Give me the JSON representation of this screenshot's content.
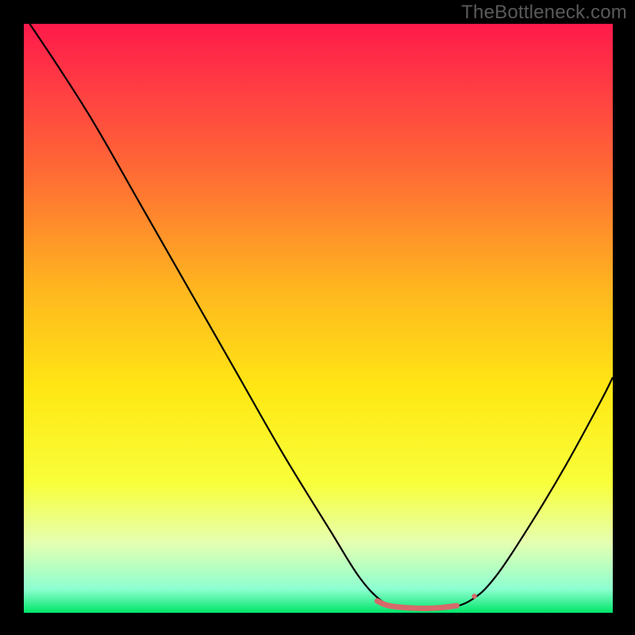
{
  "watermark": "TheBottleneck.com",
  "chart_data": {
    "type": "line",
    "title": "",
    "xlabel": "",
    "ylabel": "",
    "xlim": [
      0,
      100
    ],
    "ylim": [
      0,
      100
    ],
    "background_gradient": {
      "stops": [
        {
          "offset": 0.0,
          "color": "#ff1a4a"
        },
        {
          "offset": 0.1,
          "color": "#ff3a44"
        },
        {
          "offset": 0.25,
          "color": "#ff6a35"
        },
        {
          "offset": 0.45,
          "color": "#ffb61f"
        },
        {
          "offset": 0.62,
          "color": "#ffe714"
        },
        {
          "offset": 0.78,
          "color": "#f8ff3a"
        },
        {
          "offset": 0.88,
          "color": "#e6ffb0"
        },
        {
          "offset": 0.96,
          "color": "#8dffd0"
        },
        {
          "offset": 1.0,
          "color": "#00e56a"
        }
      ]
    },
    "series": [
      {
        "name": "bottleneck-curve",
        "color": "#000000",
        "width": 2.2,
        "comment": "y is mismatch percentage; 0 at bottom (optimum), 100 at top.",
        "points": [
          {
            "x": 1.0,
            "y": 100.0
          },
          {
            "x": 6.0,
            "y": 92.5
          },
          {
            "x": 12.0,
            "y": 83.0
          },
          {
            "x": 20.0,
            "y": 69.0
          },
          {
            "x": 28.0,
            "y": 55.0
          },
          {
            "x": 36.0,
            "y": 41.0
          },
          {
            "x": 44.0,
            "y": 27.0
          },
          {
            "x": 52.0,
            "y": 14.0
          },
          {
            "x": 57.0,
            "y": 6.0
          },
          {
            "x": 61.0,
            "y": 1.8
          },
          {
            "x": 64.0,
            "y": 0.8
          },
          {
            "x": 68.0,
            "y": 0.6
          },
          {
            "x": 72.0,
            "y": 0.8
          },
          {
            "x": 76.0,
            "y": 2.2
          },
          {
            "x": 80.0,
            "y": 6.0
          },
          {
            "x": 86.0,
            "y": 15.0
          },
          {
            "x": 92.0,
            "y": 25.0
          },
          {
            "x": 98.0,
            "y": 36.0
          },
          {
            "x": 100.0,
            "y": 40.0
          }
        ]
      },
      {
        "name": "optimum-marker",
        "color": "#d66a6a",
        "width": 7,
        "linecap": "round",
        "comment": "thick salmon segment marking optimum flat region, plus a short tick at its right end",
        "points": [
          {
            "x": 60.0,
            "y": 2.0
          },
          {
            "x": 62.0,
            "y": 1.2
          },
          {
            "x": 66.0,
            "y": 0.8
          },
          {
            "x": 70.0,
            "y": 0.8
          },
          {
            "x": 73.5,
            "y": 1.2
          }
        ],
        "end_dot": {
          "x": 76.5,
          "y": 2.8,
          "r": 3.2
        }
      }
    ]
  }
}
